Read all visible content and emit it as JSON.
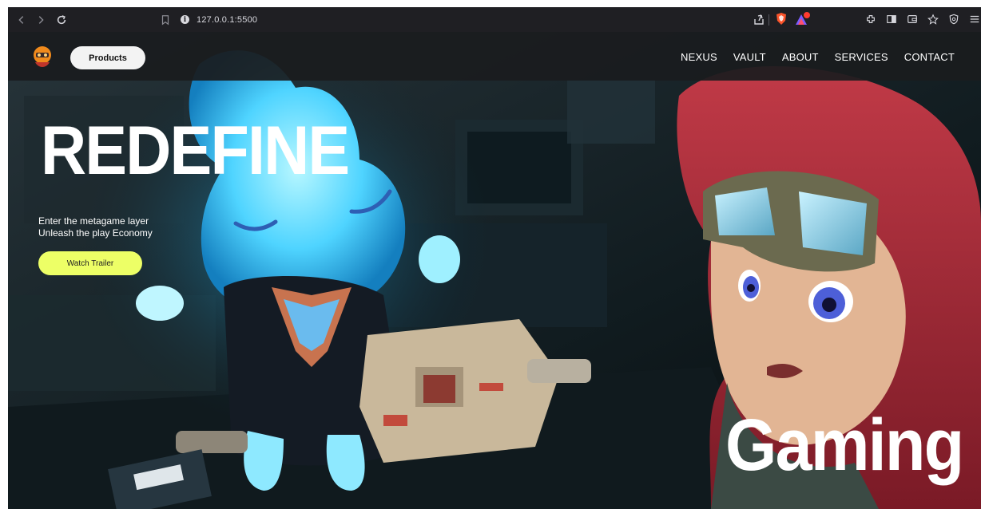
{
  "browser": {
    "url": "127.0.0.1:5500",
    "icons": [
      "back-icon",
      "forward-icon",
      "reload-icon",
      "bookmark-icon",
      "site-info-icon",
      "share-icon",
      "brave-shield-icon",
      "brave-rewards-icon",
      "extensions-icon",
      "sidebar-icon",
      "wallet-icon",
      "favorites-icon",
      "vpn-icon",
      "menu-icon"
    ]
  },
  "header": {
    "products_label": "Products",
    "nav": [
      "NEXUS",
      "VAULT",
      "ABOUT",
      "SERVICES",
      "CONTACT"
    ]
  },
  "hero": {
    "title": "REDEFINE",
    "tagline_line1": "Enter the metagame layer",
    "tagline_line2": "Unleash the play Economy",
    "cta_label": "Watch Trailer",
    "corner_word": "Gaming"
  },
  "colors": {
    "chrome_bg": "#1f1f23",
    "nav_bg": "#1a1c1e",
    "cta_bg": "#edff66",
    "products_bg": "#f3f3f3"
  }
}
